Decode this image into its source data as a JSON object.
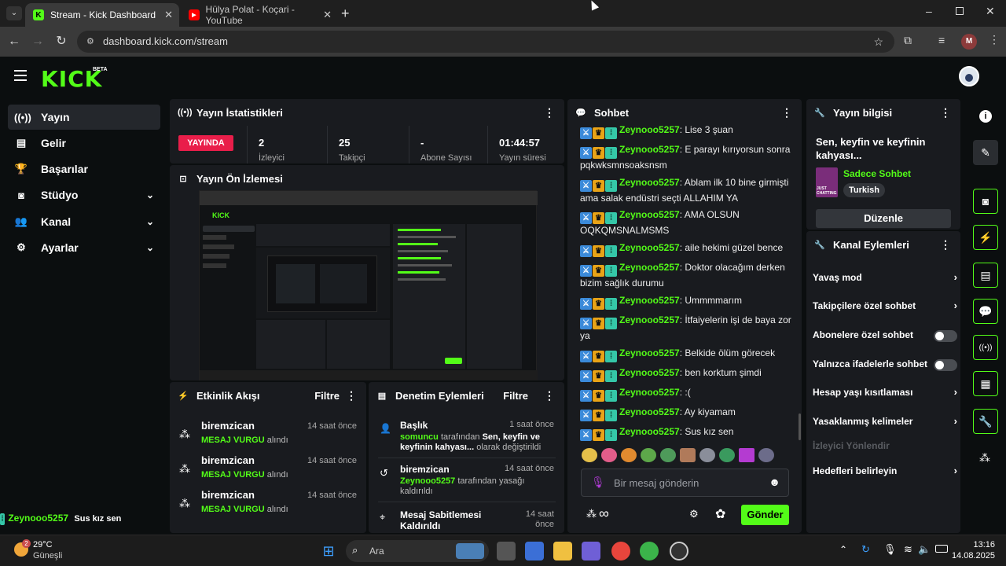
{
  "browser": {
    "tabs": [
      {
        "title": "Stream - Kick Dashboard",
        "active": true
      },
      {
        "title": "Hülya Polat - Koçari - YouTube",
        "active": false
      }
    ],
    "url": "dashboard.kick.com/stream",
    "profile_initial": "M"
  },
  "kick": {
    "logo": "KICK",
    "beta": "BETA"
  },
  "sidebar": {
    "items": [
      {
        "label": "Yayın",
        "icon": "broadcast-icon"
      },
      {
        "label": "Gelir",
        "icon": "chart-icon"
      },
      {
        "label": "Başarılar",
        "icon": "trophy-icon"
      },
      {
        "label": "Stüdyo",
        "icon": "camera-icon"
      },
      {
        "label": "Kanal",
        "icon": "users-icon"
      },
      {
        "label": "Ayarlar",
        "icon": "gear-icon"
      }
    ]
  },
  "stats": {
    "title": "Yayın İstatistikleri",
    "live_badge": "YAYINDA",
    "viewers": "2",
    "viewers_label": "İzleyici",
    "followers": "25",
    "followers_label": "Takipçi",
    "subs": "-",
    "subs_label": "Abone Sayısı",
    "duration": "01:44:57",
    "duration_label": "Yayın süresi"
  },
  "preview": {
    "title": "Yayın Ön İzlemesi"
  },
  "activity": {
    "title": "Etkinlik Akışı",
    "filter": "Filtre",
    "items": [
      {
        "user": "biremzican",
        "time": "14 saat önce",
        "highlight": "MESAJ VURGU",
        "suffix": "alındı"
      },
      {
        "user": "biremzican",
        "time": "14 saat önce",
        "highlight": "MESAJ VURGU",
        "suffix": "alındı"
      },
      {
        "user": "biremzican",
        "time": "14 saat önce",
        "highlight": "MESAJ VURGU",
        "suffix": "alındı"
      }
    ]
  },
  "moderation": {
    "title": "Denetim Eylemleri",
    "filter": "Filtre",
    "items": [
      {
        "title": "Başlık",
        "time": "1 saat önce",
        "actor": "somuncu",
        "mid": "tarafından",
        "bold_text": "Sen, keyfin ve keyfinin kahyası...",
        "tail": "olarak değiştirildi"
      },
      {
        "title": "biremzican",
        "time": "14 saat önce",
        "actor": "Zeynooo5257",
        "text": "tarafından yasağı kaldırıldı"
      },
      {
        "title": "Mesaj Sabitlemesi Kaldırıldı",
        "time": "14 saat önce"
      }
    ]
  },
  "chat": {
    "title": "Sohbet",
    "messages": [
      {
        "user": "Zeynooo5257",
        "text": "Lise 3 şuan"
      },
      {
        "user": "Zeynooo5257",
        "text": "E parayı kırıyorsun sonra pqkwksmnsoaksnsm"
      },
      {
        "user": "Zeynooo5257",
        "text": "Ablam ilk 10 bine girmişti ama salak endüstri seçti ALLAHIM YA"
      },
      {
        "user": "Zeynooo5257",
        "text": "AMA OLSUN OQKQMSNALMSMS"
      },
      {
        "user": "Zeynooo5257",
        "text": "aile hekimi güzel bence"
      },
      {
        "user": "Zeynooo5257",
        "text": "Doktor olacağım derken bizim sağlık durumu"
      },
      {
        "user": "Zeynooo5257",
        "text": "Ummmmarım"
      },
      {
        "user": "Zeynooo5257",
        "text": "İtfaiyelerin işi de baya zor ya"
      },
      {
        "user": "Zeynooo5257",
        "text": "Belkide ölüm görecek"
      },
      {
        "user": "Zeynooo5257",
        "text": "ben korktum şimdi"
      },
      {
        "user": "Zeynooo5257",
        "text": ":("
      },
      {
        "user": "Zeynooo5257",
        "text": "Ay kiyamam"
      },
      {
        "user": "Zeynooo5257",
        "text": "Sus kız sen"
      }
    ],
    "input_placeholder": "Bir mesaj gönderin",
    "send_label": "Gönder",
    "infinity": "∞"
  },
  "stream_info": {
    "title": "Yayın bilgisi",
    "stream_title": "Sen, keyfin ve keyfinin kahyası...",
    "category": "Sadece Sohbet",
    "category_thumb_text": "JUST CHATTING",
    "language": "Turkish",
    "edit_label": "Düzenle"
  },
  "channel_actions": {
    "title": "Kanal Eylemleri",
    "items": [
      {
        "label": "Yavaş mod",
        "control": "chevron"
      },
      {
        "label": "Takipçilere özel sohbet",
        "control": "chevron"
      },
      {
        "label": "Abonelere özel sohbet",
        "control": "toggle"
      },
      {
        "label": "Yalnızca ifadelerle sohbet",
        "control": "toggle"
      },
      {
        "label": "Hesap yaşı kısıtlaması",
        "control": "chevron"
      },
      {
        "label": "Yasaklanmış kelimeler",
        "control": "chevron"
      },
      {
        "label": "İzleyici Yönlendir",
        "control": "none",
        "disabled": true
      },
      {
        "label": "Hedefleri belirleyin",
        "control": "chevron"
      }
    ]
  },
  "overlay": {
    "user": "Zeynooo5257",
    "text": "Sus kız sen"
  },
  "taskbar": {
    "weather_temp": "29°C",
    "weather_desc": "Güneşli",
    "weather_badge": "2",
    "search": "Ara",
    "time": "13:16",
    "date": "14.08.2025"
  },
  "colors": {
    "accent": "#53fc18",
    "live": "#e91e4a",
    "panel": "#191b1f",
    "bg": "#0b0e0f"
  }
}
